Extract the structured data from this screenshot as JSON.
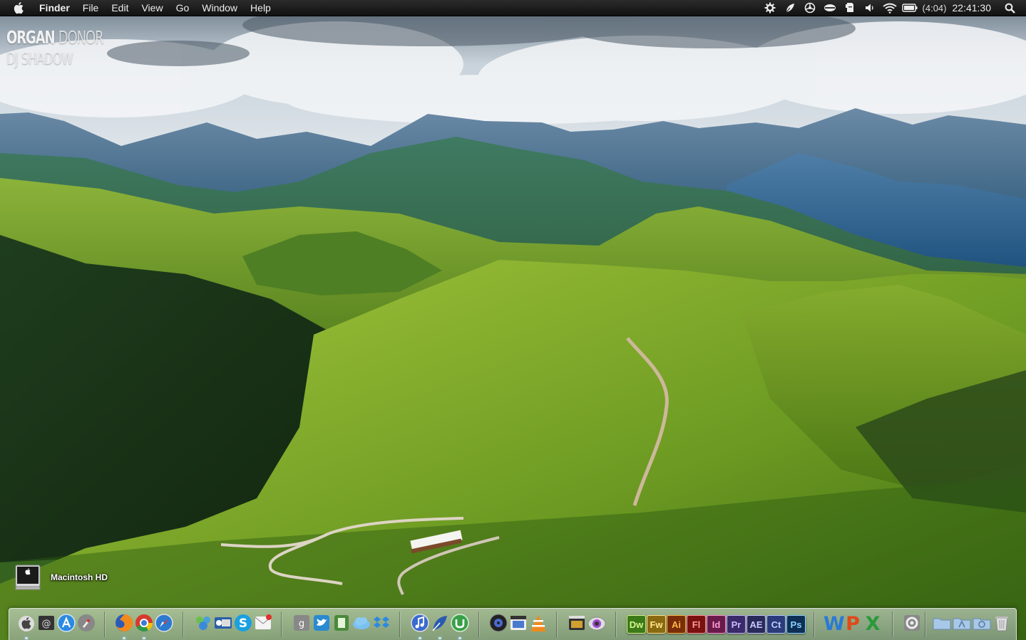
{
  "menubar": {
    "apple_icon": "apple-logo-icon",
    "app_name": "Finder",
    "menus": [
      "File",
      "Edit",
      "View",
      "Go",
      "Window",
      "Help"
    ],
    "status_icons": [
      "gear-icon",
      "leaf-icon",
      "steering-wheel-icon",
      "cloud-icon",
      "evernote-icon",
      "volume-icon",
      "wifi-icon",
      "battery-icon"
    ],
    "battery_text": "(4:04)",
    "clock": "22:41:30",
    "spotlight_icon": "spotlight-search-icon"
  },
  "now_playing": {
    "title_part1": "ORGAN",
    "title_part2": "DONOR",
    "artist": "DJ SHADOW"
  },
  "desktop": {
    "drive_label": "Macintosh HD",
    "drive_icon": "hard-drive-icon"
  },
  "dock": {
    "adobe_apps": [
      {
        "label": "Dw",
        "bg": "#3c7a18",
        "fg": "#d6f58c"
      },
      {
        "label": "Fw",
        "bg": "#8a6a10",
        "fg": "#ffe68a"
      },
      {
        "label": "Ai",
        "bg": "#7a2e08",
        "fg": "#ffb84a"
      },
      {
        "label": "Fl",
        "bg": "#7a1010",
        "fg": "#ff9a9a"
      },
      {
        "label": "Id",
        "bg": "#6a1a4a",
        "fg": "#ff9ad6"
      },
      {
        "label": "Pr",
        "bg": "#3a2a6a",
        "fg": "#c8b8ff"
      },
      {
        "label": "AE",
        "bg": "#2a2a5a",
        "fg": "#c8c8ff"
      },
      {
        "label": "Ct",
        "bg": "#2a3a7a",
        "fg": "#b8d0ff"
      },
      {
        "label": "Ps",
        "bg": "#0e2f55",
        "fg": "#8ad0ff"
      }
    ],
    "office_apps": [
      {
        "label": "W",
        "color": "#2a7ad5"
      },
      {
        "label": "P",
        "color": "#e04a1a"
      },
      {
        "label": "X",
        "color": "#2a9a3a"
      }
    ]
  }
}
